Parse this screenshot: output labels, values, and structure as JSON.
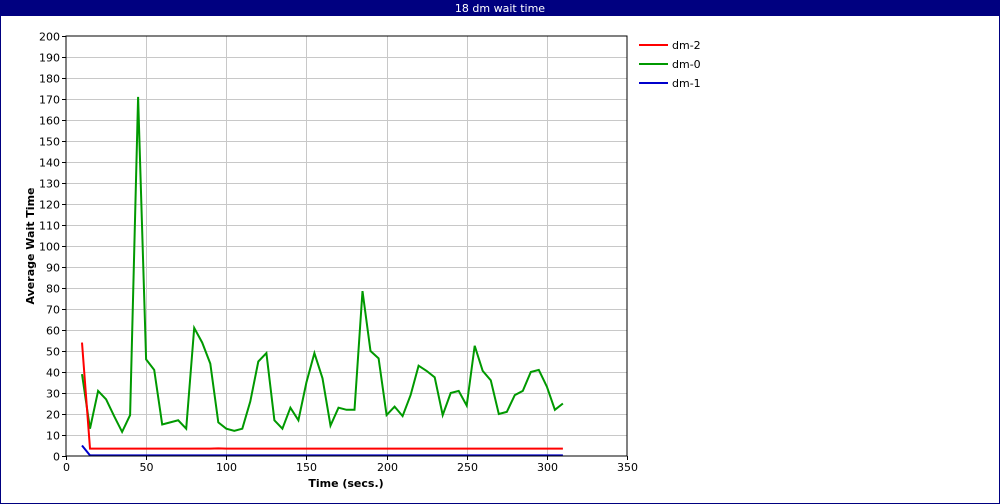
{
  "window": {
    "title": "18 dm wait time"
  },
  "chart_data": {
    "type": "line",
    "title": "18 dm wait time",
    "xlabel": "Time (secs.)",
    "ylabel": "Average Wait Time",
    "xlim": [
      0,
      350
    ],
    "ylim": [
      0,
      200
    ],
    "xticks": [
      0,
      50,
      100,
      150,
      200,
      250,
      300,
      350
    ],
    "yticks": [
      0,
      10,
      20,
      30,
      40,
      50,
      60,
      70,
      80,
      90,
      100,
      110,
      120,
      130,
      140,
      150,
      160,
      170,
      180,
      190,
      200
    ],
    "grid": true,
    "legend_position": "top-right, outside plot",
    "series": [
      {
        "name": "dm-2",
        "color": "#ff0000",
        "x": [
          10,
          15,
          20,
          25,
          30,
          35,
          40,
          45,
          50,
          55,
          60,
          65,
          70,
          75,
          80,
          85,
          90,
          95,
          100,
          105,
          110,
          115,
          120,
          125,
          130,
          135,
          140,
          145,
          150,
          155,
          160,
          165,
          170,
          175,
          180,
          185,
          190,
          195,
          200,
          205,
          210,
          215,
          220,
          225,
          230,
          235,
          240,
          245,
          250,
          255,
          260,
          265,
          270,
          275,
          280,
          285,
          290,
          295,
          300,
          305,
          310
        ],
        "y": [
          54,
          3.5,
          3.5,
          3.5,
          3.5,
          3.5,
          3.5,
          3.5,
          3.5,
          3.5,
          3.5,
          3.5,
          3.5,
          3.5,
          3.5,
          3.5,
          3.5,
          3.6,
          3.5,
          3.5,
          3.5,
          3.5,
          3.5,
          3.5,
          3.5,
          3.5,
          3.5,
          3.5,
          3.5,
          3.5,
          3.5,
          3.5,
          3.5,
          3.5,
          3.5,
          3.5,
          3.5,
          3.5,
          3.5,
          3.5,
          3.5,
          3.5,
          3.5,
          3.5,
          3.5,
          3.5,
          3.5,
          3.5,
          3.5,
          3.5,
          3.5,
          3.5,
          3.5,
          3.5,
          3.5,
          3.5,
          3.5,
          3.5,
          3.5,
          3.5,
          3.5
        ]
      },
      {
        "name": "dm-0",
        "color": "#009900",
        "x": [
          10,
          15,
          20,
          25,
          30,
          35,
          40,
          45,
          50,
          55,
          60,
          65,
          70,
          75,
          80,
          85,
          90,
          95,
          100,
          105,
          110,
          115,
          120,
          125,
          130,
          135,
          140,
          145,
          150,
          155,
          160,
          165,
          170,
          175,
          180,
          185,
          190,
          195,
          200,
          205,
          210,
          215,
          220,
          225,
          230,
          235,
          240,
          245,
          250,
          255,
          260,
          265,
          270,
          275,
          280,
          285,
          290,
          295,
          300,
          305,
          310
        ],
        "y": [
          39,
          13,
          31,
          27,
          19,
          11.5,
          19.5,
          171,
          46,
          41,
          15,
          16,
          17,
          13,
          61,
          54,
          44,
          16,
          13,
          12,
          13,
          26,
          45,
          49,
          17,
          13,
          23,
          17,
          35,
          49,
          37,
          14.5,
          23,
          22,
          22,
          78.5,
          50,
          46.5,
          19.5,
          23.5,
          19,
          29,
          43,
          40.5,
          37.5,
          19.5,
          30,
          31,
          24,
          52.5,
          40.5,
          36,
          20,
          21,
          29,
          31,
          40,
          41,
          33,
          22,
          25
        ]
      },
      {
        "name": "dm-1",
        "color": "#0000cc",
        "x": [
          10,
          15,
          20,
          25,
          30,
          35,
          40,
          45,
          50,
          55,
          60,
          65,
          70,
          75,
          80,
          85,
          90,
          95,
          100,
          105,
          110,
          115,
          120,
          125,
          130,
          135,
          140,
          145,
          150,
          155,
          160,
          165,
          170,
          175,
          180,
          185,
          190,
          195,
          200,
          205,
          210,
          215,
          220,
          225,
          230,
          235,
          240,
          245,
          250,
          255,
          260,
          265,
          270,
          275,
          280,
          285,
          290,
          295,
          300,
          305,
          310
        ],
        "y": [
          5,
          0.3,
          0.3,
          0.3,
          0.3,
          0.3,
          0.3,
          0.3,
          0.3,
          0.3,
          0.3,
          0.3,
          0.3,
          0.3,
          0.3,
          0.3,
          0.3,
          0.3,
          0.3,
          0.3,
          0.3,
          0.3,
          0.3,
          0.3,
          0.3,
          0.3,
          0.3,
          0.3,
          0.3,
          0.3,
          0.3,
          0.3,
          0.3,
          0.3,
          0.3,
          0.3,
          0.3,
          0.3,
          0.3,
          0.3,
          0.3,
          0.3,
          0.3,
          0.3,
          0.3,
          0.3,
          0.3,
          0.3,
          0.3,
          0.3,
          0.3,
          0.3,
          0.3,
          0.3,
          0.3,
          0.3,
          0.3,
          0.3,
          0.3,
          0.3,
          0.3
        ]
      }
    ]
  }
}
